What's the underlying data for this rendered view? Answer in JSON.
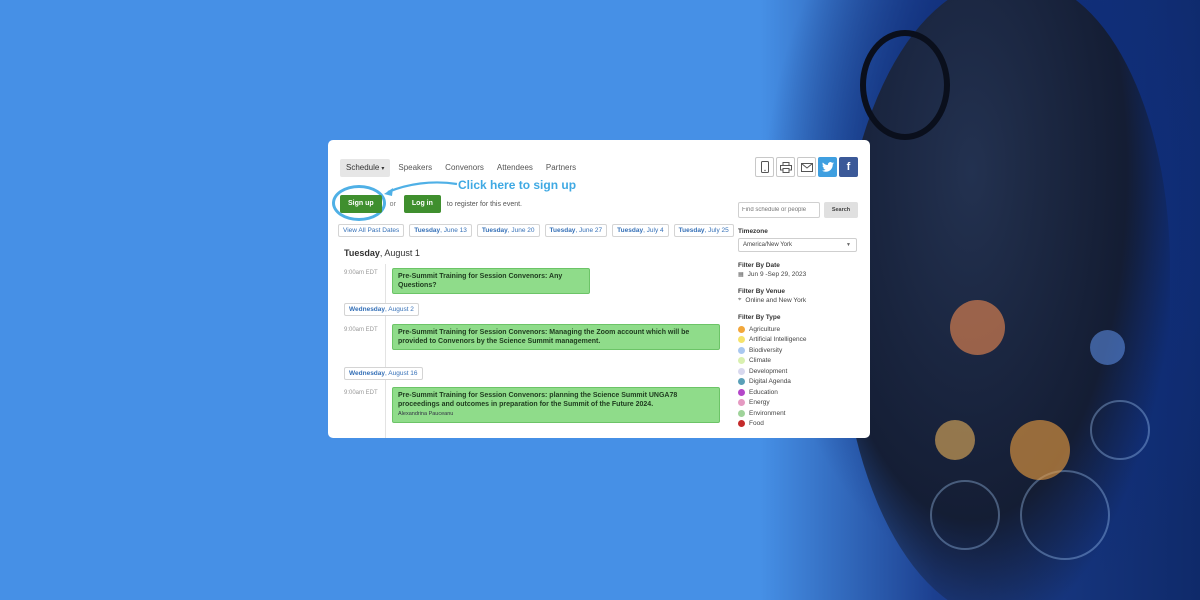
{
  "nav": {
    "schedule_label": "Schedule",
    "caret": "▾",
    "items": [
      "Speakers",
      "Convenors",
      "Attendees",
      "Partners"
    ]
  },
  "share": {
    "mobile_icon": "mobile-icon",
    "print_icon": "print-icon",
    "email_icon": "email-icon",
    "twitter_icon": "twitter-icon",
    "facebook_icon": "facebook-icon"
  },
  "auth": {
    "signup_label": "Sign up",
    "or_label": "or",
    "login_label": "Log in",
    "register_text": "to register for this event.",
    "callout": "Click here to sign up"
  },
  "date_nav": {
    "past_label": "View All Past Dates",
    "dates": [
      {
        "day": "Tuesday",
        "date": ", June 13"
      },
      {
        "day": "Tuesday",
        "date": ", June 20"
      },
      {
        "day": "Tuesday",
        "date": ", June 27"
      },
      {
        "day": "Tuesday",
        "date": ", July 4"
      },
      {
        "day": "Tuesday",
        "date": ", July 25"
      }
    ]
  },
  "schedule": {
    "day1": {
      "weekday": "Tuesday",
      "date": ", August 1"
    },
    "event1": {
      "time": "9:00am EDT",
      "title": "Pre-Summit Training for Session Convenors: Any Questions?"
    },
    "day2": {
      "weekday": "Wednesday",
      "date": ", August 2"
    },
    "event2": {
      "time": "9:00am EDT",
      "title": "Pre-Summit Training for Session Convenors: Managing the Zoom account which will be provided to Convenors by the Science Summit management."
    },
    "day3": {
      "weekday": "Wednesday",
      "date": ", August 16"
    },
    "event3": {
      "time": "9:00am EDT",
      "title": "Pre-Summit Training for Session Convenors: planning the Science Summit UNGA78 proceedings and outcomes in preparation for the Summit of the Future 2024.",
      "speaker": "Alexandrina Pauceanu"
    }
  },
  "sidebar": {
    "search_placeholder": "Find schedule or people",
    "search_button": "Search",
    "timezone_label": "Timezone",
    "timezone_value": "America/New York",
    "filter_date_label": "Filter By Date",
    "filter_date_value": "Jun 9 -Sep 29, 2023",
    "filter_venue_label": "Filter By Venue",
    "filter_venue_value": "Online and New York",
    "filter_type_label": "Filter By Type",
    "types": [
      {
        "name": "Agriculture",
        "color": "#f2a73b"
      },
      {
        "name": "Artificial Intelligence",
        "color": "#f6e36b"
      },
      {
        "name": "Biodiversity",
        "color": "#a9c8f0"
      },
      {
        "name": "Climate",
        "color": "#d9f0b0"
      },
      {
        "name": "Development",
        "color": "#d8d8ee"
      },
      {
        "name": "Digital Agenda",
        "color": "#5aa0b8"
      },
      {
        "name": "Education",
        "color": "#b447c9"
      },
      {
        "name": "Energy",
        "color": "#e59ac2"
      },
      {
        "name": "Environment",
        "color": "#9fd39a"
      },
      {
        "name": "Food",
        "color": "#c42b2b"
      }
    ]
  }
}
